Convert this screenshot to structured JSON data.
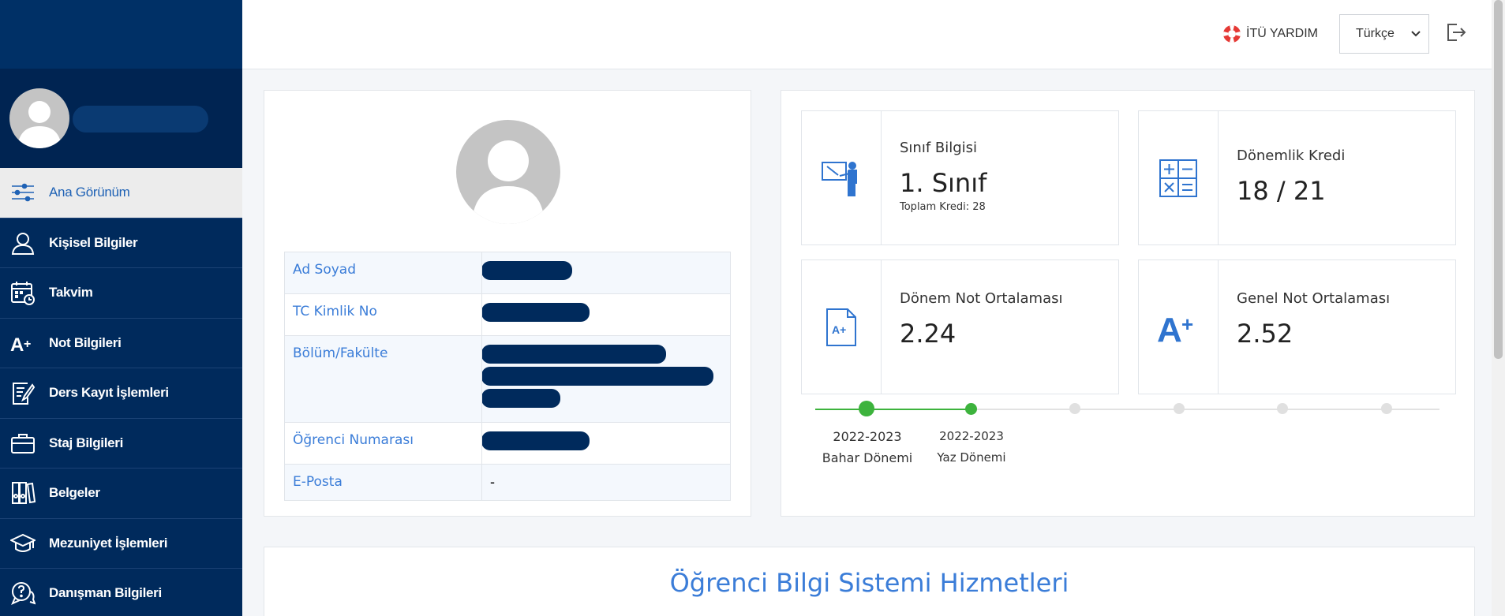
{
  "topbar": {
    "help_label": "İTÜ YARDIM",
    "language": "Türkçe"
  },
  "sidebar": {
    "items": [
      {
        "label": "Ana Görünüm",
        "icon": "sliders-icon",
        "active": true
      },
      {
        "label": "Kişisel Bilgiler",
        "icon": "user-icon"
      },
      {
        "label": "Takvim",
        "icon": "calendar-icon"
      },
      {
        "label": "Not Bilgileri",
        "icon": "grade-icon"
      },
      {
        "label": "Ders Kayıt İşlemleri",
        "icon": "registration-icon"
      },
      {
        "label": "Staj Bilgileri",
        "icon": "briefcase-icon"
      },
      {
        "label": "Belgeler",
        "icon": "binders-icon"
      },
      {
        "label": "Mezuniyet İşlemleri",
        "icon": "graduation-cap-icon"
      },
      {
        "label": "Danışman Bilgileri",
        "icon": "advisor-chat-icon"
      }
    ]
  },
  "profile": {
    "rows": [
      {
        "label": "Ad Soyad",
        "value": ""
      },
      {
        "label": "TC Kimlik No",
        "value": ""
      },
      {
        "label": "Bölüm/Fakülte",
        "value": ""
      },
      {
        "label": "Öğrenci Numarası",
        "value": ""
      },
      {
        "label": "E-Posta",
        "value": "-"
      }
    ]
  },
  "stats": {
    "class": {
      "title": "Sınıf Bilgisi",
      "value": "1. Sınıf",
      "sub": "Toplam Kredi: 28"
    },
    "credit": {
      "title": "Dönemlik Kredi",
      "value": "18 / 21"
    },
    "term_gpa": {
      "title": "Dönem Not Ortalaması",
      "value": "2.24"
    },
    "general_gpa": {
      "title": "Genel Not Ortalaması",
      "value": "2.52"
    }
  },
  "timeline": [
    {
      "year": "2022-2023",
      "term": "Bahar Dönemi"
    },
    {
      "year": "2022-2023",
      "term": "Yaz Dönemi"
    }
  ],
  "services": {
    "title": "Öğrenci Bilgi Sistemi Hizmetleri"
  },
  "colors": {
    "sidebar": "#002a5c",
    "accent": "#3b7dd8",
    "timeline_active": "#3db33d"
  }
}
